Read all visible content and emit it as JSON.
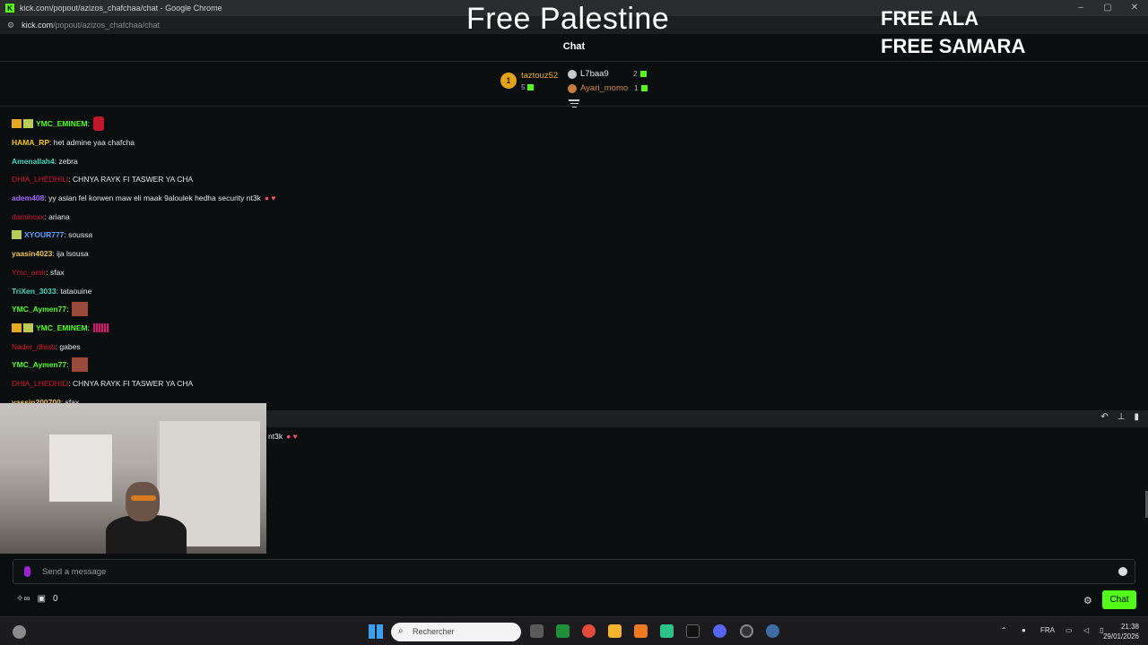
{
  "browser": {
    "window_title": "kick.com/popout/azizos_chafchaa/chat - Google Chrome",
    "url_domain": "kick.com",
    "url_path": "/popout/azizos_chafchaa/chat"
  },
  "overlay": {
    "center_text": "Free Palestine",
    "right_line1": "FREE ALA",
    "right_line2": "FREE SAMARA"
  },
  "chat": {
    "title": "Chat",
    "leaderboard": [
      {
        "rank": "1",
        "name": "taztouz52",
        "count": "5"
      },
      {
        "name": "L7baa9",
        "count": "2"
      },
      {
        "name": "Ayari_momo",
        "count": "1"
      }
    ],
    "messages": [
      {
        "user": "YMC_EMINEM",
        "color": "#53fc18",
        "text": ""
      },
      {
        "user": "HAMA_RP",
        "color": "#f5c518",
        "text": "het admine yaa chafcha"
      },
      {
        "user": "Amenallah4",
        "color": "#43d6c2",
        "text": "zebra"
      },
      {
        "user": "DHIA_LHEDHILI",
        "color": "#d6172f",
        "text": "CHNYA RAYK FI TASWER YA CHA"
      },
      {
        "user": "adem408",
        "color": "#a56bff",
        "text": "yy aslan fel korwen maw eli maak 9aloulek hedha security nt3k"
      },
      {
        "user": "daminoxx",
        "color": "#d6172f",
        "text": "ariana"
      },
      {
        "user": "XYOUR777",
        "color": "#5aa2ff",
        "text": "soussa"
      },
      {
        "user": "yaasin4023",
        "color": "#f0c45a",
        "text": "ija lsousa"
      },
      {
        "user": "Ymc_amir",
        "color": "#d6172f",
        "text": "sfax"
      },
      {
        "user": "TriXen_3033",
        "color": "#43d6c2",
        "text": "tataouine"
      },
      {
        "user": "YMC_Aymen77",
        "color": "#53fc18",
        "text": ""
      },
      {
        "user": "YMC_EMINEM",
        "color": "#53fc18",
        "text": ""
      },
      {
        "user": "Nader_dhiab",
        "color": "#d6172f",
        "text": "gabes"
      },
      {
        "user": "YMC_Aymen77",
        "color": "#53fc18",
        "text": ""
      },
      {
        "user": "DHIA_LHEDHILI",
        "color": "#d6172f",
        "text": "CHNYA RAYK FI TASWER YA CHA"
      },
      {
        "user": "yassin200700",
        "color": "#f0c45a",
        "text": "sfax"
      }
    ],
    "pinned_fragment": "nt3k",
    "input_placeholder": "Send a message",
    "bottom_count": "0",
    "chat_button": "Chat",
    "accent": "#53fc18"
  },
  "taskbar": {
    "search_placeholder": "Rechercher",
    "language": "FRA",
    "time": "21:38",
    "date": "29/01/2026"
  }
}
